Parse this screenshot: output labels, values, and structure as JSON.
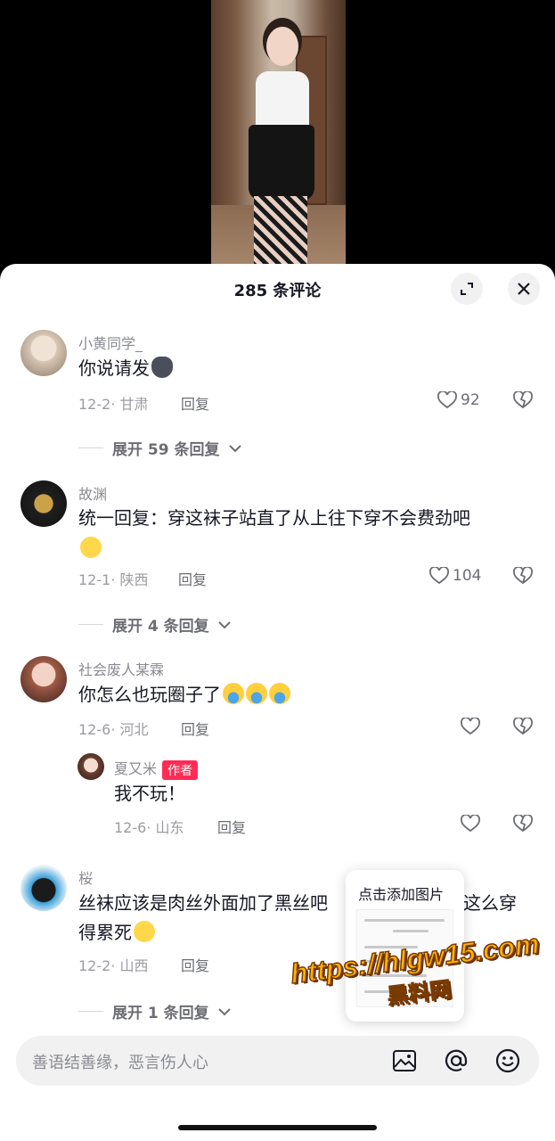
{
  "sheet": {
    "title": "285 条评论"
  },
  "comments": [
    {
      "username": "小黄同学_",
      "text": "你说请发",
      "emoji": "cat-emoji",
      "date_location": "12-2· 甘肃",
      "reply_label": "回复",
      "likes": "92",
      "expand_label": "展开 59 条回复"
    },
    {
      "username": "故渊",
      "text": "统一回复：穿这袜子站直了从上往下穿不会费劲吧",
      "emoji": "worried-emoji",
      "date_location": "12-1· 陕西",
      "reply_label": "回复",
      "likes": "104",
      "expand_label": "展开 4 条回复"
    },
    {
      "username": "社会废人某霖",
      "text": "你怎么也玩圈子了",
      "emoji": "crying-emoji",
      "date_location": "12-6· 河北",
      "reply_label": "回复",
      "likes": "",
      "reply": {
        "username": "夏又米",
        "author_tag": "作者",
        "text": "我不玩！",
        "date_location": "12-6· 山东",
        "reply_label": "回复"
      }
    },
    {
      "username": "桜",
      "text_line1": "丝袜应该是肉丝外面加了黑丝吧",
      "text_line1_tail": "这么穿",
      "text_line2": "得累死",
      "emoji": "smile-emoji",
      "date_location": "12-2· 山西",
      "reply_label": "回复",
      "expand_label": "展开 1 条回复"
    }
  ],
  "popup": {
    "label": "点击添加图片"
  },
  "watermark": {
    "url": "https://hlgw15.com",
    "cn": "黑料网"
  },
  "input_bar": {
    "placeholder": "善语结善缘，恶言伤人心"
  },
  "icons": [
    "expand-icon",
    "close-icon",
    "heart-icon",
    "dislike-heart-icon",
    "chevron-down-icon",
    "image-icon",
    "at-icon",
    "emoji-icon"
  ],
  "colors": {
    "accent": "#fe2c55",
    "watermark": "#ffb300"
  }
}
